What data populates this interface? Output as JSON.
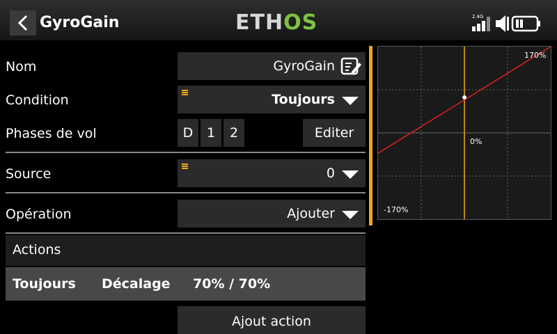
{
  "header": {
    "title": "GyroGain",
    "logo_left": "ETH",
    "logo_right": "OS",
    "radio_band": "2.4G"
  },
  "form": {
    "name_label": "Nom",
    "name_value": "GyroGain",
    "condition_label": "Condition",
    "condition_value": "Toujours",
    "phases_label": "Phases de vol",
    "phases": [
      "D",
      "1",
      "2"
    ],
    "edit_label": "Editer",
    "source_label": "Source",
    "source_value": "0",
    "operation_label": "Opération",
    "operation_value": "Ajouter"
  },
  "actions": {
    "header": "Actions",
    "row": {
      "condition": "Toujours",
      "type": "Décalage",
      "value": "70% / 70%"
    },
    "add_label": "Ajout action"
  },
  "chart_data": {
    "type": "line",
    "x": [
      -100,
      100
    ],
    "series": [
      {
        "values": [
          -40,
          170
        ]
      }
    ],
    "point": {
      "x": 0,
      "y": 70
    },
    "labels": {
      "top_right": "170%",
      "center": "0%",
      "bottom_left": "-170%"
    },
    "xlim": [
      -100,
      100
    ],
    "ylim": [
      -170,
      170
    ],
    "grid": true,
    "colors": {
      "curve": "#e02020",
      "cursor": "#f0a820",
      "grid": "#6a6a6a"
    }
  }
}
